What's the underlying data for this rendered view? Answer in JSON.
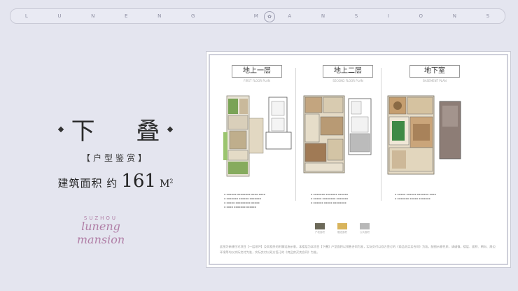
{
  "banner": {
    "letters": [
      "L",
      "U",
      "N",
      "E",
      "N",
      "G",
      "",
      "M",
      "A",
      "N",
      "S",
      "I",
      "O",
      "N",
      "S"
    ]
  },
  "hero": {
    "title": "下 叠",
    "subtitle": "【户型鉴赏】",
    "area_label": "建筑面积 约",
    "area_value": "161",
    "area_unit": "M",
    "area_sup": "2"
  },
  "logo": {
    "top": "SUZHOU",
    "script": "luneng mansion"
  },
  "card": {
    "columns": [
      {
        "title": "地上一层",
        "caption": "FIRST FLOOR PLAN"
      },
      {
        "title": "地上二层",
        "caption": "SECOND FLOOR PLAN"
      },
      {
        "title": "地下室",
        "caption": "BASEMENT PLAN"
      }
    ],
    "legend": [
      {
        "label": "产权面积",
        "color": "#6c6959"
      },
      {
        "label": "赠送面积",
        "color": "#d8b45c"
      },
      {
        "label": "公共面积",
        "color": "#b8b8b8"
      }
    ],
    "disclaimer": "此图为新建住宅项目【一层地坪】及其相关的附属设施示意，本楼层为本项目【下叠】户型面积以销售合同为准，实际交付以双方签订的《商品房买卖合同》为准。配图示意性质，请谨慎，楼层、面积、朝向、周边环境等均以实际交付为准，实际交付以双方签订的《商品房买卖合同》为准。"
  },
  "colors": {
    "background": "#e4e5ef",
    "card": "#ffffff",
    "accent_logo": "#b07ea6"
  }
}
